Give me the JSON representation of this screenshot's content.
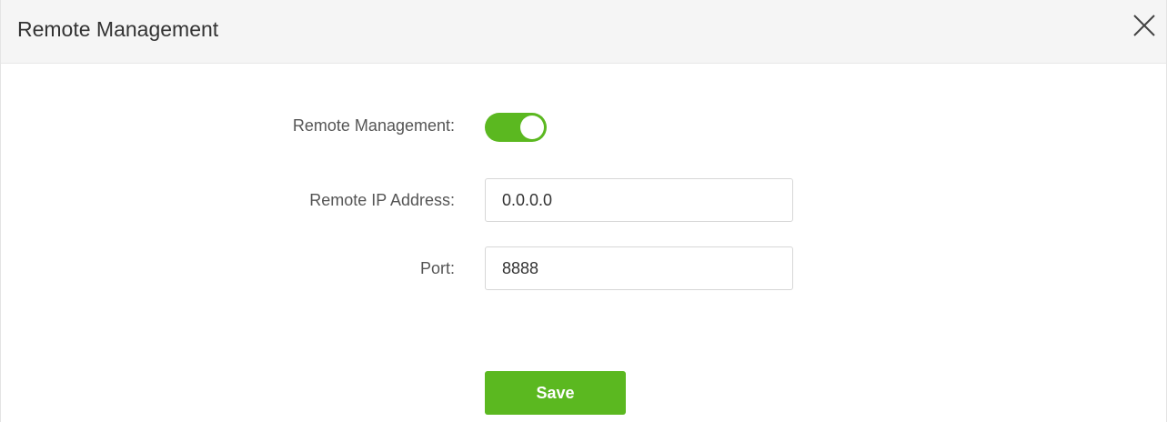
{
  "dialog": {
    "title": "Remote Management",
    "close_icon": "close-icon"
  },
  "form": {
    "remote_management": {
      "label": "Remote Management:",
      "enabled": true
    },
    "remote_ip": {
      "label": "Remote IP Address:",
      "value": "0.0.0.0"
    },
    "port": {
      "label": "Port:",
      "value": "8888"
    },
    "save_label": "Save"
  },
  "colors": {
    "accent": "#5bb820",
    "header_bg": "#f5f5f5",
    "label_text": "#555555"
  }
}
